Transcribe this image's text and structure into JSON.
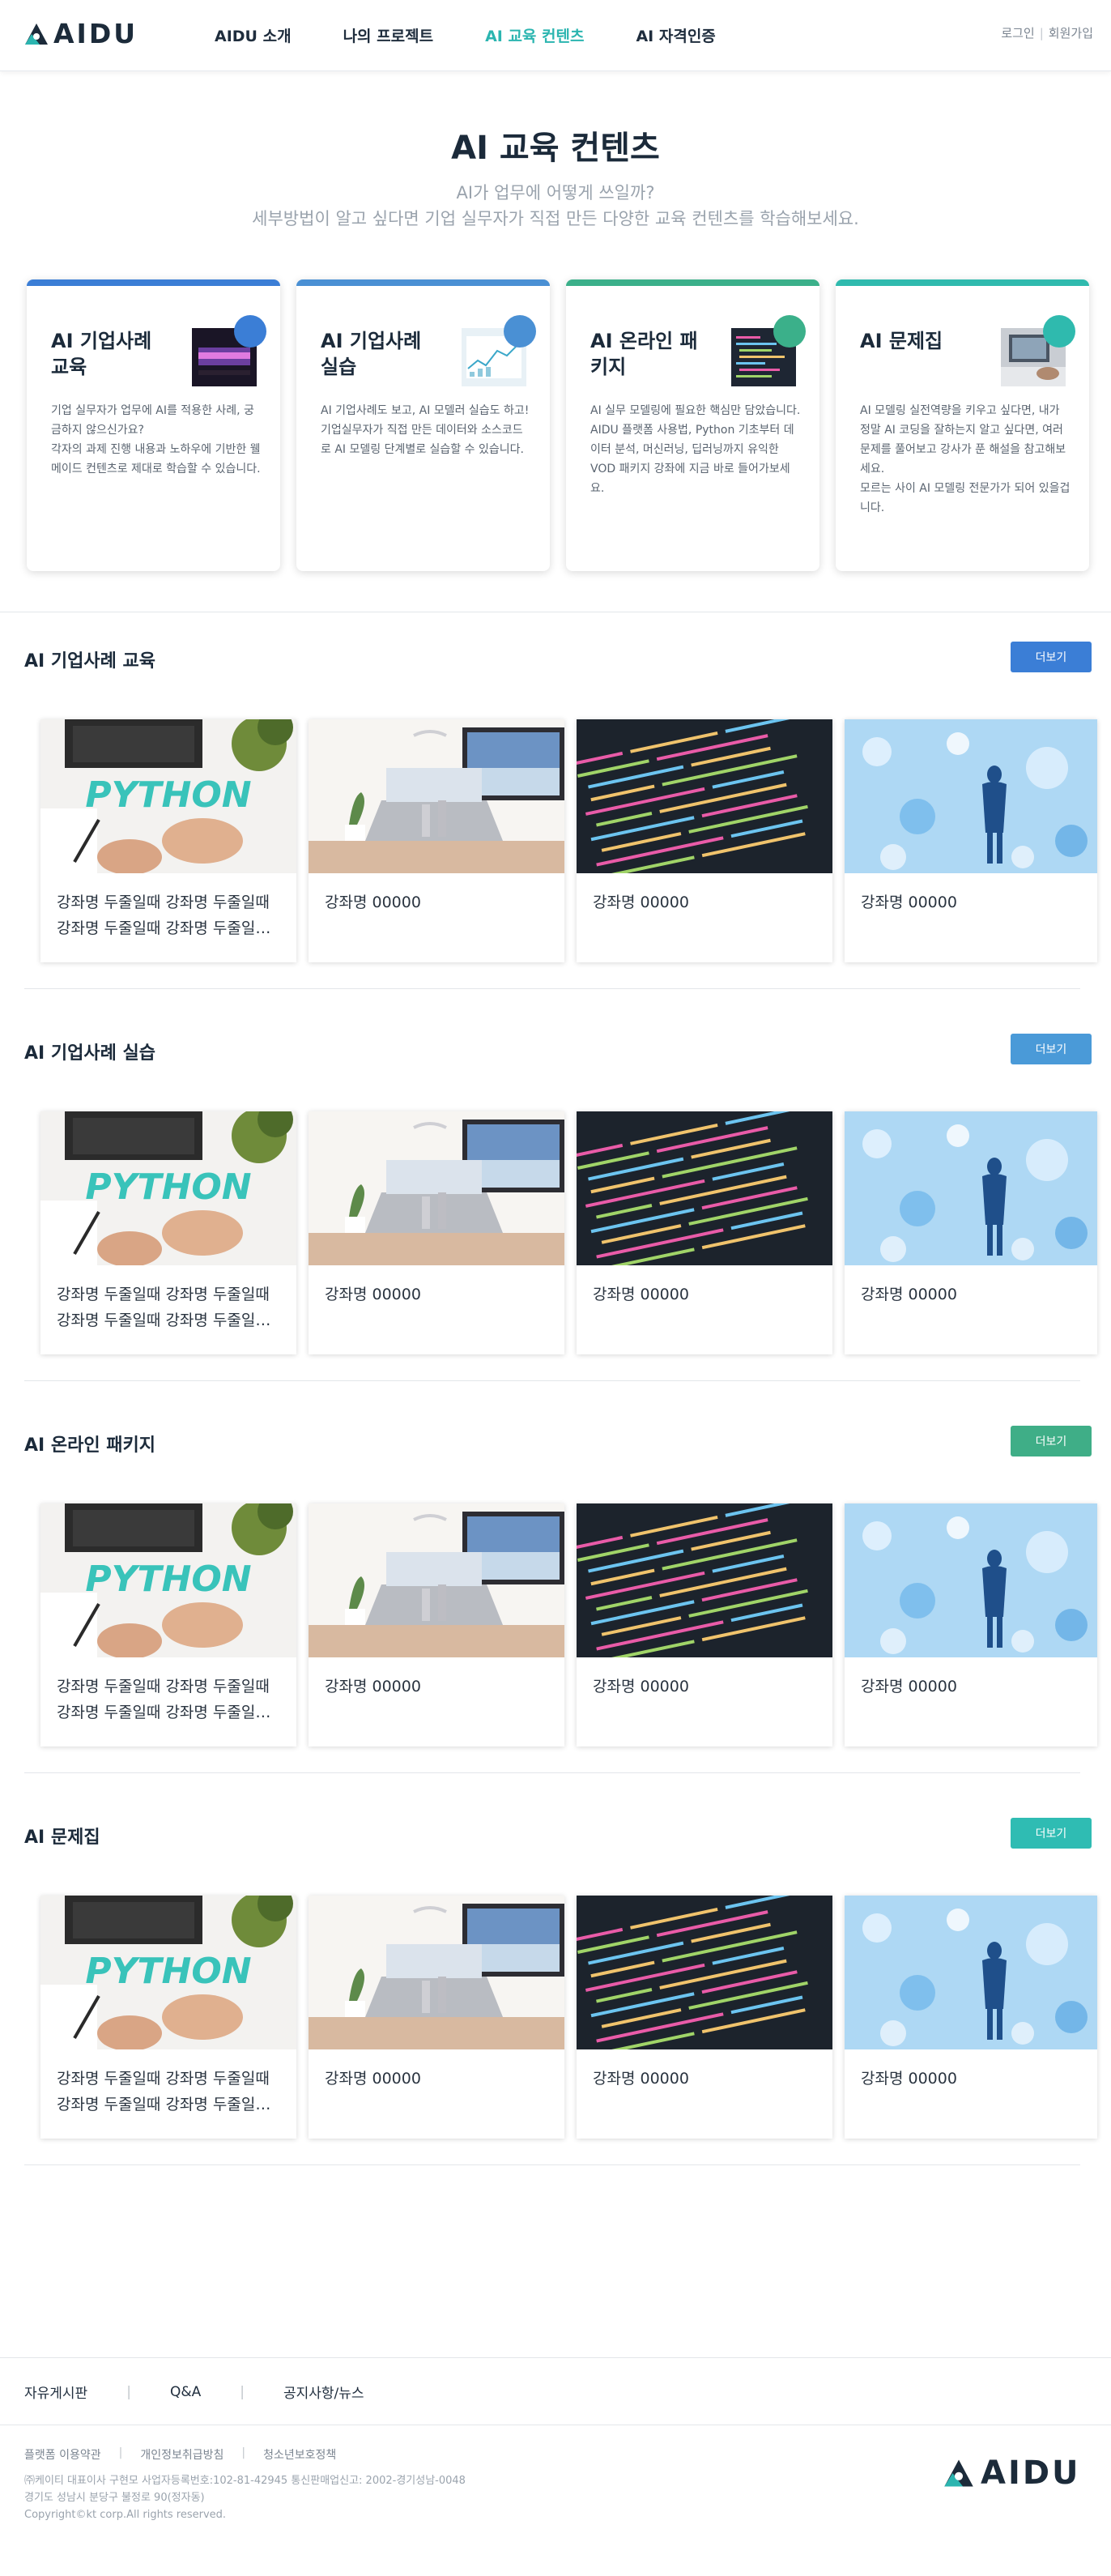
{
  "header": {
    "logo": "AIDU",
    "nav": [
      "AIDU 소개",
      "나의 프로젝트",
      "AI 교육 컨텐츠",
      "AI 자격인증"
    ],
    "active_index": 2,
    "login": "로그인",
    "signup": "회원가입"
  },
  "hero": {
    "title": "AI 교육 컨텐츠",
    "line1": "AI가 업무에 어떻게 쓰일까?",
    "line2": "세부방법이 알고 싶다면 기업 실무자가 직접 만든 다양한 교육 컨텐츠를 학습해보세요."
  },
  "features": [
    {
      "title": "AI 기업사례 교육",
      "desc": "기업 실무자가 업무에 AI를 적용한 사례, 궁금하지 않으신가요?\n각자의 과제 진행 내용과 노하우에 기반한 웰메이드 컨텐츠로 제대로 학습할 수 있습니다.",
      "color": "#3b7ed6",
      "icon": "laptop-night-thumbnail"
    },
    {
      "title": "AI 기업사례 실습",
      "desc": "AI 기업사례도 보고, AI 모델러 실습도 하고!\n기업실무자가 직접 만든 데이터와 소스코드로 AI 모델링 단계별로 실습할 수 있습니다.",
      "color": "#4a90d4",
      "icon": "chart-thumbnail"
    },
    {
      "title": "AI 온라인 패키지",
      "desc": "AI 실무 모델링에 필요한 핵심만 담았습니다.\nAIDU 플랫폼 사용법, Python 기초부터 데이터 분석, 머신러닝, 딥러닝까지 유익한 VOD 패키지 강좌에 지금 바로 들어가보세요.",
      "color": "#3bb08a",
      "icon": "code-thumbnail"
    },
    {
      "title": "AI 문제집",
      "desc": "AI 모델링 실전역량을 키우고 싶다면, 내가 정말 AI 코딩을 잘하는지 알고 싶다면, 여러문제를 풀어보고 강사가 푼 해설을 참고해보세요.\n모르는 사이 AI 모델링 전문가가 되어 있을겁니다.",
      "color": "#2fbaae",
      "icon": "workspace-thumbnail"
    }
  ],
  "sections": [
    {
      "title": "AI 기업사례 교육",
      "more": "더보기",
      "color": "#3b7ed6"
    },
    {
      "title": "AI 기업사례 실습",
      "more": "더보기",
      "color": "#4a9ad8"
    },
    {
      "title": "AI 온라인 패키지",
      "more": "더보기",
      "color": "#3fae87"
    },
    {
      "title": "AI 문제집",
      "more": "더보기",
      "color": "#2fbcb3"
    }
  ],
  "courses": {
    "long_line1": "강좌명 두줄일때 강좌명 두줄일때",
    "long_line2": "강좌명 두줄일때 강좌명 두줄일때 강좌명",
    "short": "강좌명 00000",
    "python_text": "PYTHON"
  },
  "footer": {
    "links": [
      "자유게시판",
      "Q&A",
      "공지사항/뉴스"
    ],
    "policies": [
      "플랫폼 이용약관",
      "개인정보취급방침",
      "청소년보호정책"
    ],
    "info1": "㈜케이티 대표이사 구현모 사업자등록번호:102-81-42945 통신판매업신고: 2002-경기성남-0048",
    "info2": "경기도 성남시 분당구 불정로 90(정자동)",
    "copyright": "Copyright©kt corp.All rights reserved.",
    "logo": "AIDU"
  }
}
